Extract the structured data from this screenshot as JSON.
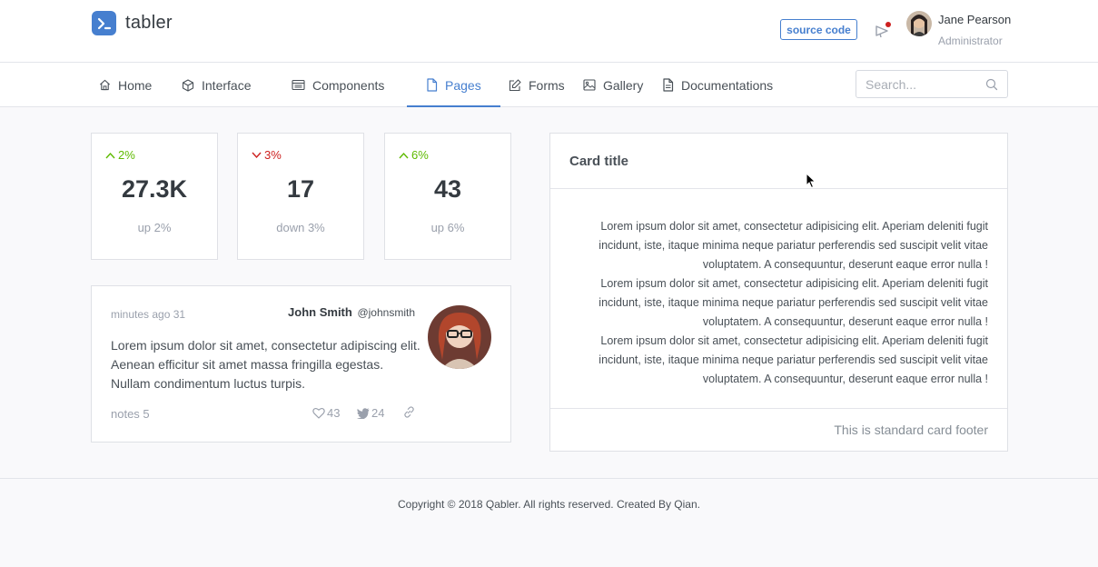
{
  "brand": {
    "name": "tabler",
    "color": "#467fcf"
  },
  "header": {
    "source_button": "source code",
    "user": {
      "name": "Jane Pearson",
      "role": "Administrator"
    }
  },
  "nav": {
    "items": [
      {
        "label": "Home",
        "icon": "home-icon"
      },
      {
        "label": "Interface",
        "icon": "box-icon"
      },
      {
        "label": "Components",
        "icon": "calendar-icon"
      },
      {
        "label": "Pages",
        "icon": "file-icon",
        "active": true
      },
      {
        "label": "Forms",
        "icon": "edit-icon"
      },
      {
        "label": "Gallery",
        "icon": "image-icon"
      },
      {
        "label": "Documentations",
        "icon": "file-text-icon"
      }
    ],
    "search_placeholder": "Search..."
  },
  "stats": [
    {
      "change": "2%",
      "direction": "up",
      "value": "27.3K",
      "label": "up 2%"
    },
    {
      "change": "3%",
      "direction": "down",
      "value": "17",
      "label": "down 3%"
    },
    {
      "change": "6%",
      "direction": "up",
      "value": "43",
      "label": "up 6%"
    }
  ],
  "post": {
    "time": "minutes ago 31",
    "author": "John Smith",
    "handle": "@johnsmith",
    "body": "Lorem ipsum dolor sit amet, consectetur adipiscing elit. Aenean efficitur sit amet massa fringilla egestas. Nullam condimentum luctus turpis.",
    "notes": "notes 5",
    "likes": "43",
    "tweets": "24"
  },
  "card": {
    "title": "Card title",
    "paragraphs": [
      "Lorem ipsum dolor sit amet, consectetur adipisicing elit. Aperiam deleniti fugit incidunt, iste, itaque minima neque pariatur perferendis sed suscipit velit vitae voluptatem. A consequuntur, deserunt eaque error nulla !",
      "Lorem ipsum dolor sit amet, consectetur adipisicing elit. Aperiam deleniti fugit incidunt, iste, itaque minima neque pariatur perferendis sed suscipit velit vitae voluptatem. A consequuntur, deserunt eaque error nulla !",
      "Lorem ipsum dolor sit amet, consectetur adipisicing elit. Aperiam deleniti fugit incidunt, iste, itaque minima neque pariatur perferendis sed suscipit velit vitae voluptatem. A consequuntur, deserunt eaque error nulla !"
    ],
    "footer": "This is standard card footer"
  },
  "footer": {
    "copyright": "Copyright © 2018 Qabler. All rights reserved. Created By Qian."
  },
  "colors": {
    "up": "#5eba00",
    "down": "#cd201f",
    "accent": "#467fcf"
  }
}
